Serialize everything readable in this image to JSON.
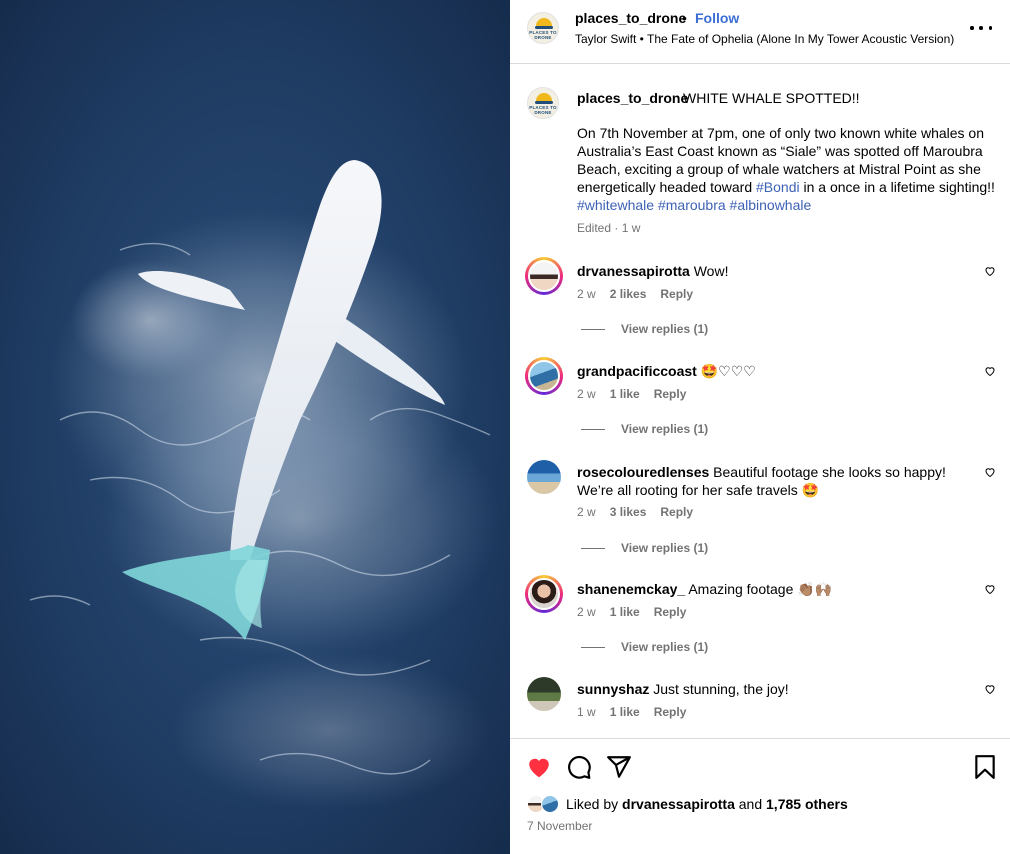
{
  "post": {
    "username": "places_to_drone",
    "follow_label": "Follow",
    "separator": "•",
    "audio": "Taylor Swift • The Fate of Ophelia (Alone In My Tower Acoustic Version)",
    "avatar_text": "PLACES TO DRONE"
  },
  "caption": {
    "username": "places_to_drone",
    "first_line": "WHITE WHALE SPOTTED!!",
    "body_text": "On 7th November at 7pm, one of only two known white whales on Australia’s East Coast known as “Siale” was spotted off Maroubra Beach, exciting a group of whale watchers at Mistral Point as she energetically headed toward",
    "tag_bondi": "#Bondi",
    "body_text_2": "in a once in a lifetime sighting!!",
    "tag_1": "#whitewhale",
    "tag_2": "#maroubra",
    "tag_3": "#albinowhale",
    "meta": "Edited · 1 w"
  },
  "comments": [
    {
      "user": "drvanessapirotta",
      "text": "Wow!",
      "time": "2 w",
      "likes": "2 likes",
      "reply": "Reply",
      "view_replies": "View replies (1)"
    },
    {
      "user": "grandpacificcoast",
      "text": "🤩♡♡♡",
      "time": "2 w",
      "likes": "1 like",
      "reply": "Reply",
      "view_replies": "View replies (1)"
    },
    {
      "user": "rosecolouredlenses",
      "text": "Beautiful footage she looks so happy! We’re all rooting for her safe travels 🤩",
      "time": "2 w",
      "likes": "3 likes",
      "reply": "Reply",
      "view_replies": "View replies (1)"
    },
    {
      "user": "shanenemckay_",
      "text": "Amazing footage 👏🏽🙌🏽",
      "time": "2 w",
      "likes": "1 like",
      "reply": "Reply",
      "view_replies": "View replies (1)"
    },
    {
      "user": "sunnyshaz",
      "text": "Just stunning, the joy!",
      "time": "1 w",
      "likes": "1 like",
      "reply": "Reply"
    }
  ],
  "footer": {
    "liked_by_prefix": "Liked by",
    "liked_by_user": "drvanessapirotta",
    "and": "and",
    "others": "1,785 others",
    "date": "7 November"
  },
  "colors": {
    "like_red": "#ff3040",
    "link_blue": "#3b6ed4",
    "hashtag_blue": "#3e62b6",
    "secondary_text": "#737373",
    "ocean_dark": "#1d3b62"
  }
}
